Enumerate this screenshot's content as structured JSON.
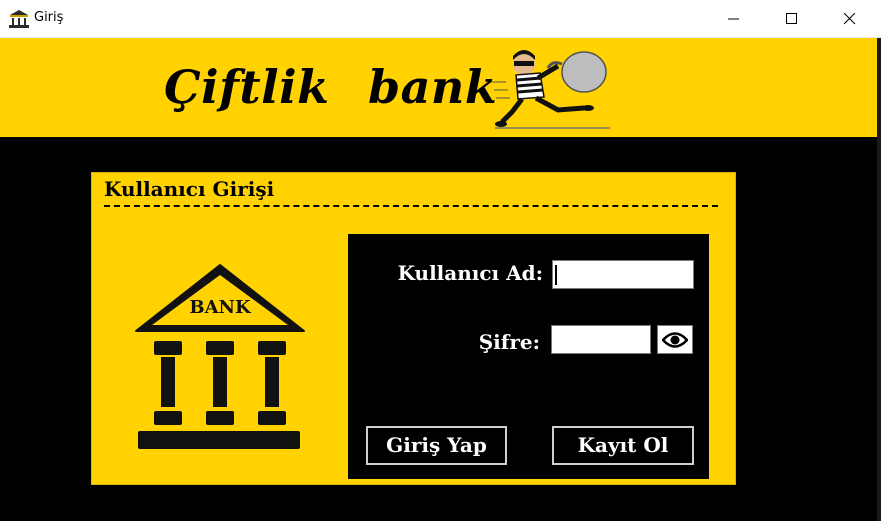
{
  "window": {
    "title": "Giriş",
    "app_icon": "bank-icon"
  },
  "header": {
    "brand": "Çiftlik bank",
    "mascot_icon": "thief-icon"
  },
  "login": {
    "title": "Kullanıcı Girişi",
    "username_label": "Kullanıcı Ad:",
    "username_value": "",
    "password_label": "Şifre:",
    "password_value": "",
    "show_password_icon": "eye-icon",
    "login_button": "Giriş Yap",
    "register_button": "Kayıt Ol",
    "bank_illustration_icon": "bank-building-icon",
    "bank_sign": "BANK"
  },
  "colors": {
    "accent": "#FFD200",
    "background": "#000000"
  }
}
